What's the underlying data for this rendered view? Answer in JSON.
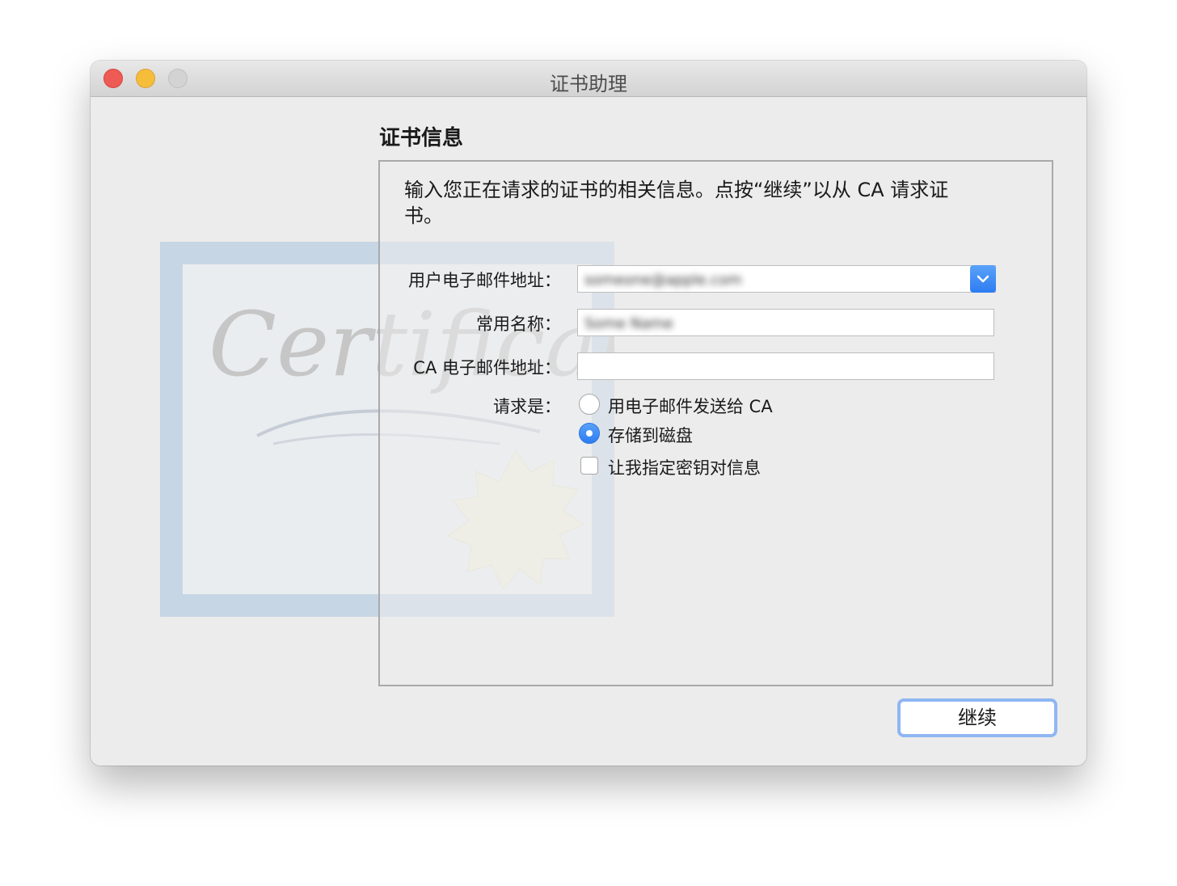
{
  "window": {
    "title": "证书助理",
    "controls": {
      "close": "close-button",
      "minimize": "minimize-button",
      "zoom": "zoom-button"
    }
  },
  "background_art": {
    "certificate_word": "Certificate"
  },
  "section": {
    "title": "证书信息"
  },
  "intro": {
    "text": "输入您正在请求的证书的相关信息。点按“继续”以从 CA 请求证书。"
  },
  "form": {
    "email_label": "用户电子邮件地址：",
    "email_value": "someone@apple.com",
    "common_name_label": "常用名称：",
    "common_name_value": "Some Name",
    "ca_email_label": "CA 电子邮件地址：",
    "ca_email_value": "",
    "request_label": "请求是：",
    "options": [
      {
        "label": "用电子邮件发送给 CA",
        "selected": false
      },
      {
        "label": "存储到磁盘",
        "selected": true
      }
    ],
    "checkbox_label": "让我指定密钥对信息",
    "checkbox_checked": false
  },
  "buttons": {
    "continue": "继续"
  },
  "colors": {
    "accent": "#2d7cf2",
    "close": "#ee5b54",
    "minimize": "#f6bd3b"
  }
}
